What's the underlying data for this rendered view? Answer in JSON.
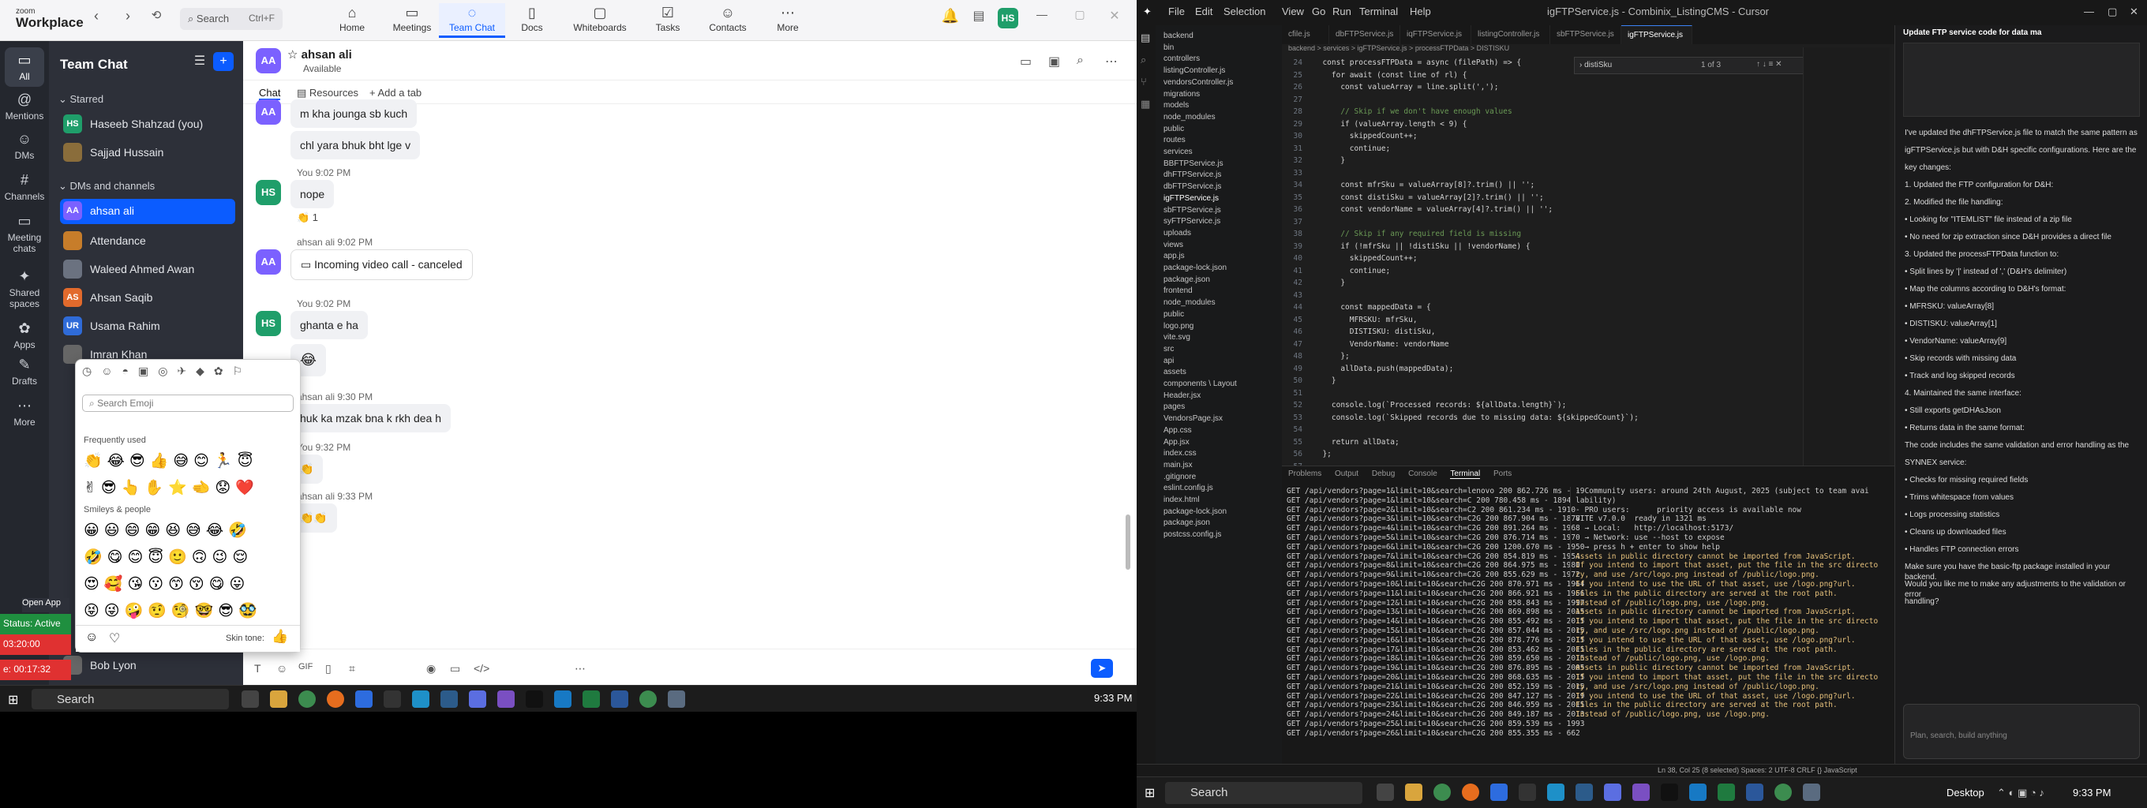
{
  "zoom": {
    "logo_small": "zoom",
    "logo_big": "Workplace",
    "search_placeholder": "Search",
    "search_shortcut": "Ctrl+F",
    "tabs": [
      "Home",
      "Meetings",
      "Team Chat",
      "Docs",
      "Whiteboards",
      "Tasks",
      "Contacts",
      "More"
    ],
    "rail": [
      "All",
      "Mentions",
      "DMs",
      "Channels",
      "Meeting chats",
      "Shared spaces",
      "Apps",
      "Drafts",
      "More"
    ],
    "chat_panel_title": "Team Chat",
    "starred_label": "Starred",
    "dms_label": "DMs and channels",
    "contacts": [
      {
        "name": "Haseeb Shahzad (you)",
        "initials": "HS",
        "color": "#1f9e6a"
      },
      {
        "name": "Sajjad Hussain",
        "initials": "",
        "color": "#8a6d3b"
      },
      {
        "name": "ahsan ali",
        "initials": "AA",
        "color": "#7b61ff"
      },
      {
        "name": "Attendance",
        "initials": "",
        "color": "#c77d2a"
      },
      {
        "name": "Waleed Ahmed Awan",
        "initials": "",
        "color": "#6b7280"
      },
      {
        "name": "Ahsan Saqib",
        "initials": "AS",
        "color": "#e26a2c"
      },
      {
        "name": "Usama Rahim",
        "initials": "UR",
        "color": "#2f6bd8"
      },
      {
        "name": "Imran Khan",
        "initials": "",
        "color": "#666"
      },
      {
        "name": "Bob Lyon",
        "initials": "",
        "color": "#666"
      }
    ],
    "conversation": {
      "name": "ahsan ali",
      "status": "Available",
      "tabs": [
        "Chat",
        "Resources",
        "Add a tab"
      ],
      "messages": [
        {
          "text": "m kha jounga sb kuch"
        },
        {
          "text": "chl yara bhuk bht lge v"
        },
        {
          "meta": "You 9:02 PM",
          "text": "nope"
        },
        {
          "text": "👏 1"
        },
        {
          "meta": "ahsan ali 9:02 PM",
          "text": "Incoming video call - canceled"
        },
        {
          "meta": "You 9:02 PM",
          "text": "ghanta e ha"
        },
        {
          "text": "😂"
        },
        {
          "meta": "ahsan ali 9:30 PM",
          "text": "huk ka mzak bna k rkh dea h"
        },
        {
          "meta": "You 9:32 PM",
          "text": "👏"
        },
        {
          "meta": "ahsan ali 9:33 PM",
          "text": "👏👏"
        }
      ]
    },
    "emoji_picker": {
      "search_placeholder": "Search Emoji",
      "frequent_label": "Frequently used",
      "smileys_label": "Smileys & people",
      "skin_tone_label": "Skin tone:",
      "frequent_row1": "👏😂😎👍😅😊🏃😇",
      "frequent_row2": "✌😎👆✋⭐🫲😟❤️",
      "smileys_row1": "😀😃😄😁😆😅😂🤣",
      "smileys_row2": "🤣😋😊😇🙂🙃😉😌",
      "smileys_row3": "😍🥰😘😗😙😚😋😛",
      "smileys_row4": "😝😜🤪🤨🧐🤓😎🥸"
    },
    "status_badge": "Status: Active",
    "timer1": "03:20:00",
    "timer2": "e: 00:17:32",
    "open_app": "Open App"
  },
  "taskbar_left": {
    "search": "Search",
    "time": "9:33 PM"
  },
  "taskbar_right": {
    "search": "Search",
    "desktop": "Desktop",
    "time": "9:33 PM"
  },
  "vscode": {
    "menu": [
      "File",
      "Edit",
      "Selection",
      "View",
      "Go",
      "Run",
      "Terminal",
      "Help"
    ],
    "title": "igFTPService.js - Combinix_ListingCMS - Cursor",
    "tabs": [
      "dbFTPService.js",
      "igFTPService.js",
      "listingController.js",
      "igFTPService.js"
    ],
    "find_text": "distiSku",
    "find_count": "1 of 3",
    "breadcrumb": "backend > services > igFTPService.js > processFTPData > DISTISKU",
    "explorer_files": [
      "backend",
      "bin",
      "controllers",
      "listingController.js",
      "vendorsController.js",
      "migrations",
      "models",
      "node_modules",
      "public",
      "routes",
      "services",
      "BBFTPService.js",
      "dhFTPService.js",
      "dbFTPService.js",
      "igFTPService.js",
      "sbFTPService.js",
      "syFTPService.js",
      "uploads",
      "views",
      "app.js",
      "package-lock.json",
      "package.json",
      "frontend",
      "node_modules",
      "public",
      "logo.png",
      "vite.svg",
      "src",
      "api",
      "assets",
      "components \\ Layout",
      "Header.jsx",
      "pages",
      "VendorsPage.jsx",
      "App.css",
      "App.jsx",
      "index.css",
      "main.jsx",
      ".gitignore",
      "eslint.config.js",
      "index.html",
      "package-lock.json",
      "package.json",
      "postcss.config.js"
    ],
    "code": [
      {
        "ln": "24",
        "t": "  const processFTPData = async (filePath) => {"
      },
      {
        "ln": "25",
        "t": "    for await (const line of rl) {"
      },
      {
        "ln": "26",
        "t": "      const valueArray = line.split(',');"
      },
      {
        "ln": "27",
        "t": ""
      },
      {
        "ln": "28",
        "t": "      // Skip if we don't have enough values"
      },
      {
        "ln": "29",
        "t": "      if (valueArray.length < 9) {"
      },
      {
        "ln": "30",
        "t": "        skippedCount++;"
      },
      {
        "ln": "31",
        "t": "        continue;"
      },
      {
        "ln": "32",
        "t": "      }"
      },
      {
        "ln": "33",
        "t": ""
      },
      {
        "ln": "34",
        "t": "      const mfrSku = valueArray[8]?.trim() || '';"
      },
      {
        "ln": "35",
        "t": "      const distiSku = valueArray[2]?.trim() || '';"
      },
      {
        "ln": "36",
        "t": "      const vendorName = valueArray[4]?.trim() || '';"
      },
      {
        "ln": "37",
        "t": ""
      },
      {
        "ln": "38",
        "t": "      // Skip if any required field is missing"
      },
      {
        "ln": "39",
        "t": "      if (!mfrSku || !distiSku || !vendorName) {"
      },
      {
        "ln": "40",
        "t": "        skippedCount++;"
      },
      {
        "ln": "41",
        "t": "        continue;"
      },
      {
        "ln": "42",
        "t": "      }"
      },
      {
        "ln": "43",
        "t": ""
      },
      {
        "ln": "44",
        "t": "      const mappedData = {"
      },
      {
        "ln": "45",
        "t": "        MFRSKU: mfrSku,"
      },
      {
        "ln": "46",
        "t": "        DISTISKU: distiSku,"
      },
      {
        "ln": "47",
        "t": "        VendorName: vendorName"
      },
      {
        "ln": "48",
        "t": "      };"
      },
      {
        "ln": "49",
        "t": "      allData.push(mappedData);"
      },
      {
        "ln": "50",
        "t": "    }"
      },
      {
        "ln": "51",
        "t": ""
      },
      {
        "ln": "52",
        "t": "    console.log(`Processed records: ${allData.length}`);"
      },
      {
        "ln": "53",
        "t": "    console.log(`Skipped records due to missing data: ${skippedCount}`);"
      },
      {
        "ln": "54",
        "t": ""
      },
      {
        "ln": "55",
        "t": "    return allData;"
      },
      {
        "ln": "56",
        "t": "  };"
      },
      {
        "ln": "57",
        "t": ""
      },
      {
        "ln": "58",
        "t": "  const getIGAsJson = async () => {"
      },
      {
        "ln": "59",
        "t": "    const sftp = new Client();"
      },
      {
        "ln": "60",
        "t": ""
      },
      {
        "ln": "61",
        "t": "    try {"
      }
    ],
    "panel_tabs": [
      "Problems",
      "Output",
      "Debug Console",
      "Terminal",
      "Ports"
    ],
    "terminal_left": [
      "GET /api/vendors?page=1&limit=10&search=lenovo 200 862.726 ms - 19",
      "GET /api/vendors?page=1&limit=10&search=C 200 780.458 ms - 1894",
      "GET /api/vendors?page=2&limit=10&search=C2 200 861.234 ms - 1910",
      "GET /api/vendors?page=3&limit=10&search=C2G 200 867.904 ms - 1878",
      "GET /api/vendors?page=4&limit=10&search=C2G 200 891.264 ms - 1968",
      "GET /api/vendors?page=5&limit=10&search=C2G 200 876.714 ms - 1970",
      "GET /api/vendors?page=6&limit=10&search=C2G 200 1200.670 ms - 1950",
      "GET /api/vendors?page=7&limit=10&search=C2G 200 854.819 ms - 1954",
      "GET /api/vendors?page=8&limit=10&search=C2G 200 864.975 ms - 1980",
      "GET /api/vendors?page=9&limit=10&search=C2G 200 855.629 ms - 1972",
      "GET /api/vendors?page=10&limit=10&search=C2G 200 870.971 ms - 1964",
      "GET /api/vendors?page=11&limit=10&search=C2G 200 866.921 ms - 1956",
      "GET /api/vendors?page=12&limit=10&search=C2G 200 858.843 ms - 1997",
      "GET /api/vendors?page=13&limit=10&search=C2G 200 869.898 ms - 2015",
      "GET /api/vendors?page=14&limit=10&search=C2G 200 855.492 ms - 2015",
      "GET /api/vendors?page=15&limit=10&search=C2G 200 857.044 ms - 2015",
      "GET /api/vendors?page=16&limit=10&search=C2G 200 878.776 ms - 2015",
      "GET /api/vendors?page=17&limit=10&search=C2G 200 853.462 ms - 2015",
      "GET /api/vendors?page=18&limit=10&search=C2G 200 859.650 ms - 2015",
      "GET /api/vendors?page=19&limit=10&search=C2G 200 876.895 ms - 2005",
      "GET /api/vendors?page=20&limit=10&search=C2G 200 868.635 ms - 2015",
      "GET /api/vendors?page=21&limit=10&search=C2G 200 852.159 ms - 2015",
      "GET /api/vendors?page=22&limit=10&search=C2G 200 847.127 ms - 2019",
      "GET /api/vendors?page=23&limit=10&search=C2G 200 846.959 ms - 2015",
      "GET /api/vendors?page=24&limit=10&search=C2G 200 849.187 ms - 2013",
      "GET /api/vendors?page=25&limit=10&search=C2G 200 859.539 ms - 1993",
      "GET /api/vendors?page=26&limit=10&search=C2G 200 855.355 ms - 662"
    ],
    "terminal_right": [
      "- Community users: around 24th August, 2025 (subject to team avai",
      "lability)",
      "- PRO users:      priority access is available now",
      "",
      "VITE v7.0.0  ready in 1321 ms",
      "",
      "  → Local:   http://localhost:5173/",
      "  → Network: use --host to expose",
      "  → press h + enter to show help",
      "Assets in public directory cannot be imported from JavaScript.",
      "If you intend to import that asset, put the file in the src directo",
      "ry, and use /src/logo.png instead of /public/logo.png.",
      "If you intend to use the URL of that asset, use /logo.png?url.",
      "Files in the public directory are served at the root path.",
      "Instead of /public/logo.png, use /logo.png.",
      "Assets in public directory cannot be imported from JavaScript.",
      "If you intend to import that asset, put the file in the src directo",
      "ry, and use /src/logo.png instead of /public/logo.png.",
      "If you intend to use the URL of that asset, use /logo.png?url.",
      "Files in the public directory are served at the root path.",
      "Instead of /public/logo.png, use /logo.png.",
      "Assets in public directory cannot be imported from JavaScript.",
      "If you intend to import that asset, put the file in the src directo",
      "ry, and use /src/logo.png instead of /public/logo.png.",
      "If you intend to use the URL of that asset, use /logo.png?url.",
      "Files in the public directory are served at the root path.",
      "Instead of /public/logo.png, use /logo.png."
    ],
    "chat_title": "Update FTP service code for data ma",
    "chat_lines": [
      "I've updated the dhFTPService.js file to match the same pattern as",
      "igFTPService.js but with D&H specific configurations. Here are the",
      "key changes:",
      "1. Updated the FTP configuration for D&H:",
      "2. Modified the file handling:",
      "  • Looking for \"ITEMLIST\" file instead of a zip file",
      "  • No need for zip extraction since D&H provides a direct file",
      "3. Updated the processFTPData function to:",
      "  • Split lines by '|' instead of ',' (D&H's delimiter)",
      "  • Map the columns according to D&H's format:",
      "    • MFRSKU: valueArray[8]",
      "    • DISTISKU: valueArray[1]",
      "    • VendorName: valueArray[9]",
      "  • Skip records with missing data",
      "  • Track and log skipped records",
      "4. Maintained the same interface:",
      "  • Still exports getDHAsJson",
      "  • Returns data in the same format:",
      "The code includes the same validation and error handling as the",
      "SYNNEX service:",
      "  • Checks for missing required fields",
      "  • Trims whitespace from values",
      "  • Logs processing statistics",
      "  • Cleans up downloaded files",
      "  • Handles FTP connection errors",
      "Make sure you have the basic-ftp package installed in your backend.",
      "Would you like me to make any adjustments to the validation or error",
      "handling?"
    ],
    "chat_input_placeholder": "Plan, search, build anything",
    "status_text": "Ln 38, Col 25 (8 selected)  Spaces: 2  UTF-8  CRLF  {} JavaScript"
  }
}
